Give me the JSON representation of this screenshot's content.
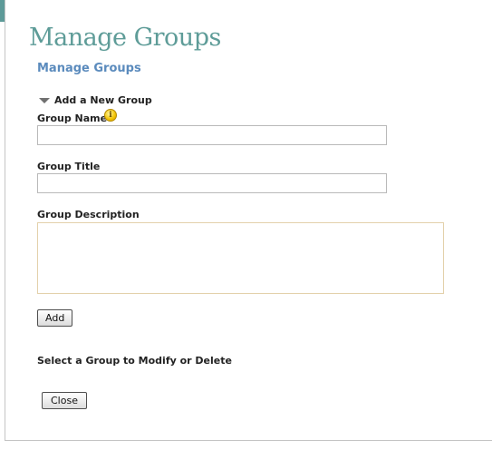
{
  "header": {
    "page_title": "Manage Groups",
    "section_title": "Manage Groups"
  },
  "add_group": {
    "toggle_label": "Add a New Group",
    "group_name_label": "Group Name",
    "group_name_value": "",
    "group_title_label": "Group Title",
    "group_title_value": "",
    "group_description_label": "Group Description",
    "group_description_value": "",
    "add_button_label": "Add",
    "info_icon_glyph": "i"
  },
  "modify": {
    "section_label": "Select a Group to Modify or Delete"
  },
  "footer": {
    "close_button_label": "Close"
  },
  "colors": {
    "topbar": "#5d9a98",
    "title": "#5e9c98",
    "section_title": "#5b8bbd"
  },
  "icons": {
    "collapse": "triangle-down-icon",
    "info": "info-icon"
  }
}
